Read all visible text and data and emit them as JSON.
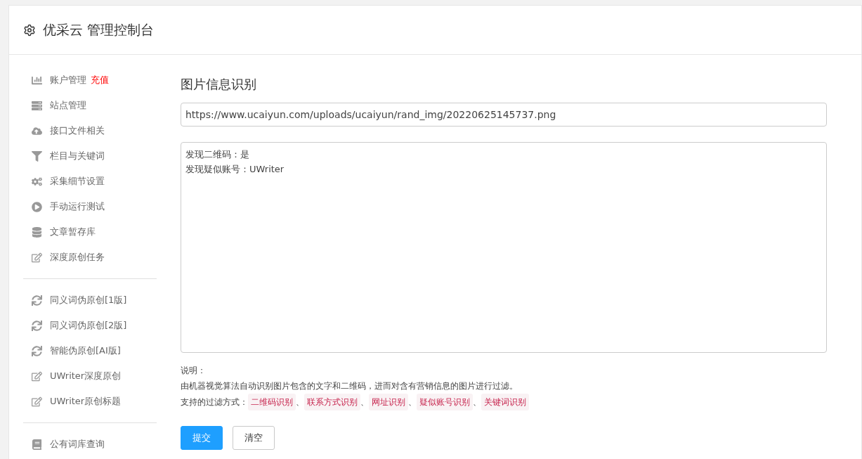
{
  "header": {
    "title": "优采云 管理控制台"
  },
  "sidebar": {
    "groups": [
      {
        "items": [
          {
            "label": "账户管理",
            "badge": "充值"
          },
          {
            "label": "站点管理"
          },
          {
            "label": "接口文件相关"
          },
          {
            "label": "栏目与关键词"
          },
          {
            "label": "采集细节设置"
          },
          {
            "label": "手动运行测试"
          },
          {
            "label": "文章暂存库"
          },
          {
            "label": "深度原创任务"
          }
        ]
      },
      {
        "items": [
          {
            "label": "同义词伪原创[1版]"
          },
          {
            "label": "同义词伪原创[2版]"
          },
          {
            "label": "智能伪原创[AI版]"
          },
          {
            "label": "UWriter深度原创"
          },
          {
            "label": "UWriter原创标题"
          }
        ]
      },
      {
        "items": [
          {
            "label": "公有词库查询"
          }
        ]
      }
    ]
  },
  "main": {
    "title": "图片信息识别",
    "url_field": {
      "value": "https://www.ucaiyun.com/uploads/ucaiyun/rand_img/20220625145737.png"
    },
    "result_box": {
      "lines": [
        "发现二维码：是",
        "发现疑似账号：UWriter"
      ]
    },
    "notes": {
      "heading": "说明：",
      "description": "由机器视觉算法自动识别图片包含的文字和二维码，进而对含有营销信息的图片进行过滤。",
      "methods_label": "支持的过滤方式：",
      "separator": "、",
      "methods": [
        "二维码识别",
        "联系方式识别",
        "网址识别",
        "疑似账号识别",
        "关键词识别"
      ]
    },
    "buttons": [
      {
        "label": "提交",
        "kind": "primary"
      },
      {
        "label": "清空",
        "kind": "default"
      }
    ]
  }
}
